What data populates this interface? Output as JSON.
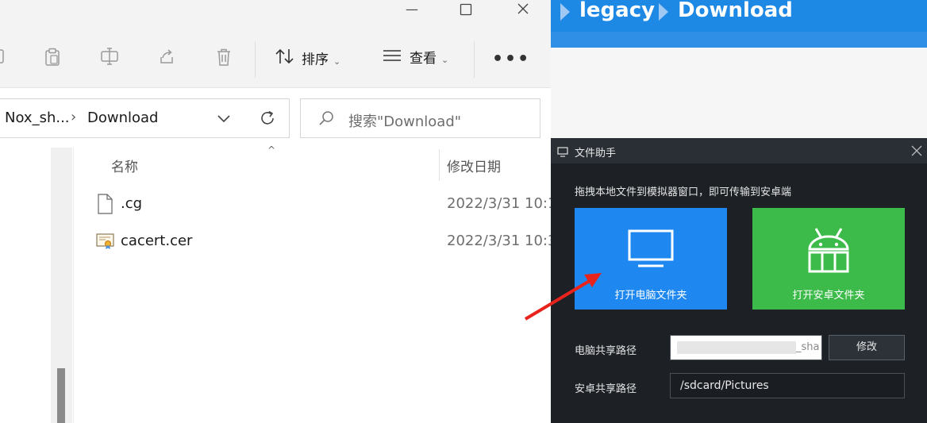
{
  "explorer": {
    "toolbar": {
      "sort_label": "排序",
      "view_label": "查看"
    },
    "address": {
      "parent_crumb": "Nox_sh...",
      "separator": "›",
      "current_crumb": "Download"
    },
    "search": {
      "placeholder": "搜索\"Download\""
    },
    "columns": {
      "name": "名称",
      "modified": "修改日期"
    },
    "files": [
      {
        "name": ".cg",
        "modified": "2022/3/31 10:1"
      },
      {
        "name": "cacert.cer",
        "modified": "2022/3/31 10:3"
      }
    ]
  },
  "nox": {
    "breadcrumb": [
      "legacy",
      "Download"
    ],
    "header_color": "#1e88e5"
  },
  "file_helper": {
    "title": "文件助手",
    "instruction": "拖拽本地文件到模拟器窗口，即可传输到安卓端",
    "open_pc_label": "打开电脑文件夹",
    "open_android_label": "打开安卓文件夹",
    "pc_path_label": "电脑共享路径",
    "pc_path_value": "_sha",
    "modify_label": "修改",
    "android_path_label": "安卓共享路径",
    "android_path_value": "/sdcard/Pictures",
    "pc_button_color": "#1e88f0",
    "android_button_color": "#3dbb4a"
  }
}
